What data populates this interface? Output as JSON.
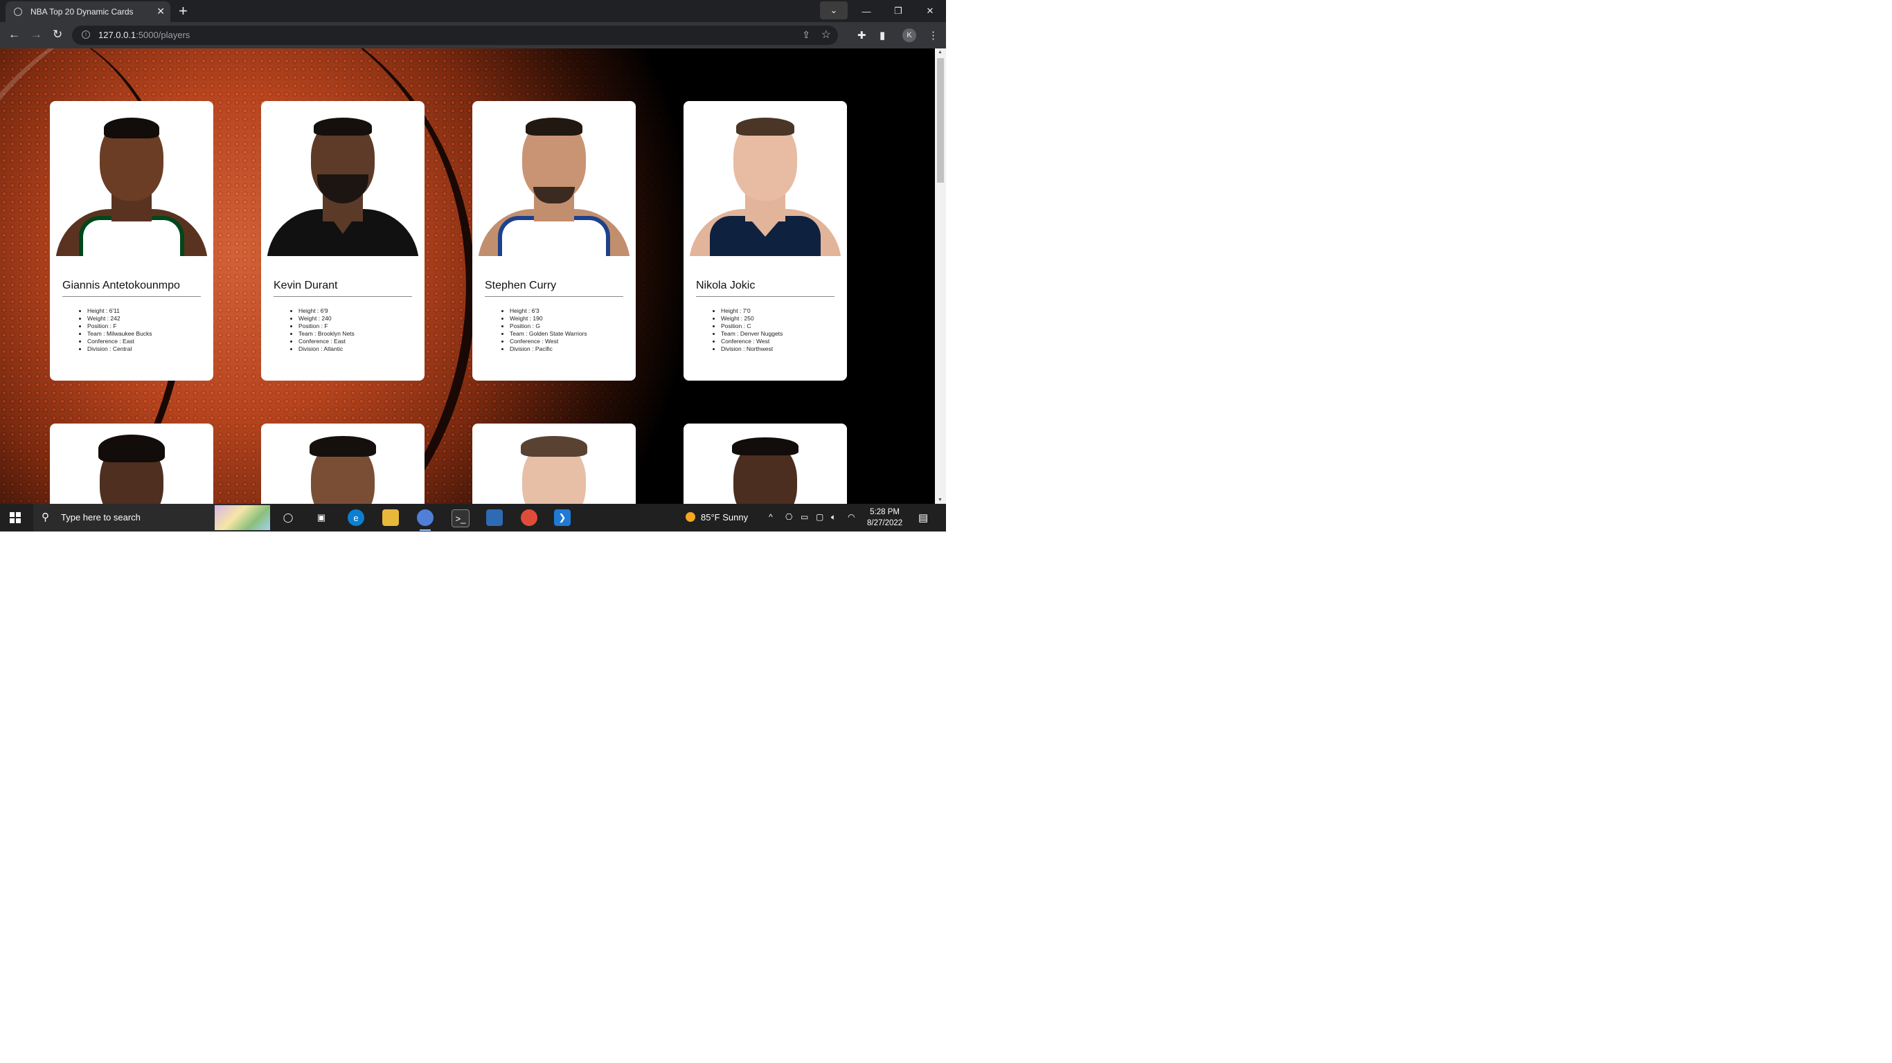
{
  "browser": {
    "tab_title": "NBA Top 20 Dynamic Cards",
    "url_host": "127.0.0.1",
    "url_path": ":5000/players",
    "profile_initial": "K"
  },
  "players": [
    {
      "name": "Giannis Antetokounmpo",
      "stats": [
        "Height : 6'11",
        "Weight : 242",
        "Position : F",
        "Team : Milwaukee Bucks",
        "Conference : East",
        "Division : Central"
      ]
    },
    {
      "name": "Kevin Durant",
      "stats": [
        "Height : 6'9",
        "Weight : 240",
        "Position : F",
        "Team : Brooklyn Nets",
        "Conference : East",
        "Division : Atlantic"
      ]
    },
    {
      "name": "Stephen Curry",
      "stats": [
        "Height : 6'3",
        "Weight : 190",
        "Position : G",
        "Team : Golden State Warriors",
        "Conference : West",
        "Division : Pacific"
      ]
    },
    {
      "name": "Nikola Jokic",
      "stats": [
        "Height : 7'0",
        "Weight : 250",
        "Position : C",
        "Team : Denver Nuggets",
        "Conference : West",
        "Division : Northwest"
      ]
    }
  ],
  "colors": {
    "bucks_jersey": "#ffffff",
    "bucks_trim": "#00471b",
    "nets_jersey": "#111111",
    "warriors_jersey": "#1d428a",
    "warriors_trim": "#ffc72c",
    "nuggets_jersey": "#0e2240"
  },
  "taskbar": {
    "search_placeholder": "Type here to search",
    "weather": "85°F  Sunny",
    "time": "5:28 PM",
    "date": "8/27/2022"
  }
}
